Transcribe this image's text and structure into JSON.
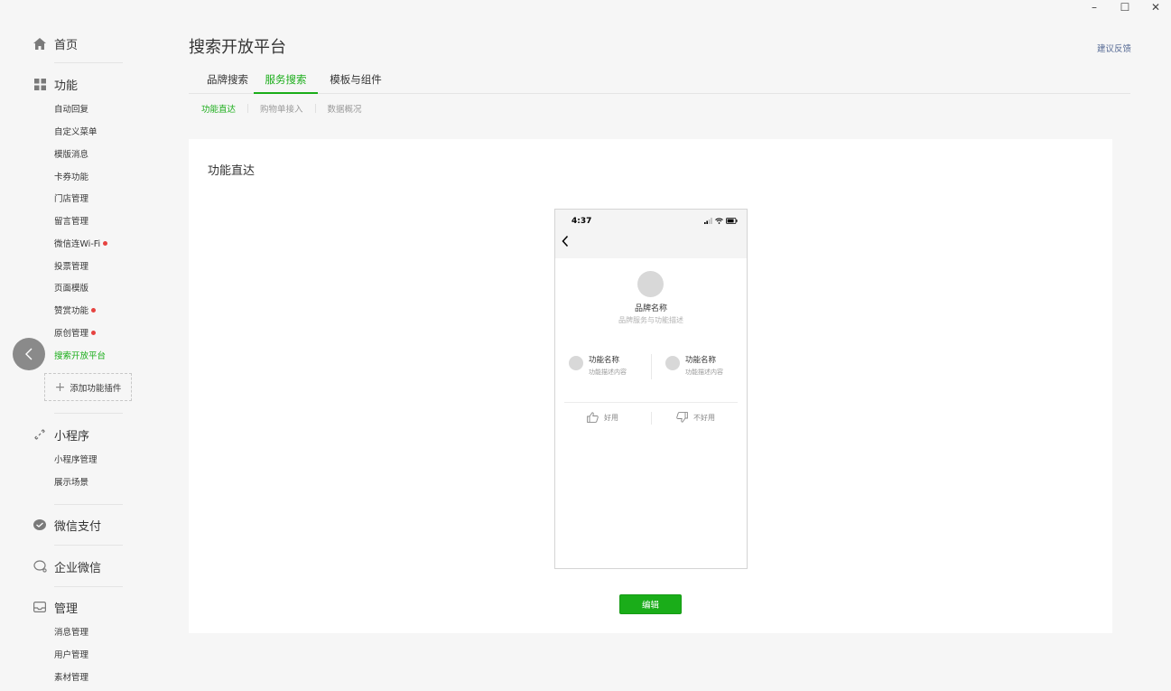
{
  "window": {
    "minimize": "–",
    "maximize": "☐",
    "close": "✕"
  },
  "sidebar": {
    "home": {
      "label": "首页",
      "icon": "home-icon"
    },
    "features": {
      "label": "功能",
      "icon": "grid-icon",
      "items": [
        "自动回复",
        "自定义菜单",
        "模版消息",
        "卡券功能",
        "门店管理",
        "留言管理",
        "微信连Wi-Fi",
        "投票管理",
        "页面模版",
        "赞赏功能",
        "原创管理",
        "搜索开放平台"
      ],
      "add_plugin": "添加功能插件"
    },
    "miniprogram": {
      "label": "小程序",
      "icon": "link-icon",
      "items": [
        "小程序管理",
        "展示场景"
      ]
    },
    "wechat_pay": {
      "label": "微信支付",
      "icon": "pay-icon"
    },
    "work_wechat": {
      "label": "企业微信",
      "icon": "chat-icon"
    },
    "manage": {
      "label": "管理",
      "icon": "inbox-icon",
      "items": [
        "消息管理",
        "用户管理",
        "素材管理"
      ]
    }
  },
  "header": {
    "title": "搜索开放平台",
    "feedback": "建议反馈",
    "tabs": [
      "品牌搜索",
      "服务搜索",
      "模板与组件"
    ],
    "active_tab": "服务搜索",
    "subtabs": [
      "功能直达",
      "购物单接入",
      "数据概况"
    ],
    "active_subtab": "功能直达"
  },
  "card": {
    "title": "功能直达",
    "phone": {
      "time": "4:37",
      "brand_name": "品牌名称",
      "brand_desc": "品牌服务与功能描述",
      "features": [
        {
          "name": "功能名称",
          "desc": "功能描述内容"
        },
        {
          "name": "功能名称",
          "desc": "功能描述内容"
        }
      ],
      "like": "好用",
      "dislike": "不好用"
    },
    "edit_button": "编辑"
  },
  "colors": {
    "accent": "#1aad19",
    "link": "#576b95",
    "badge": "#e64340"
  }
}
